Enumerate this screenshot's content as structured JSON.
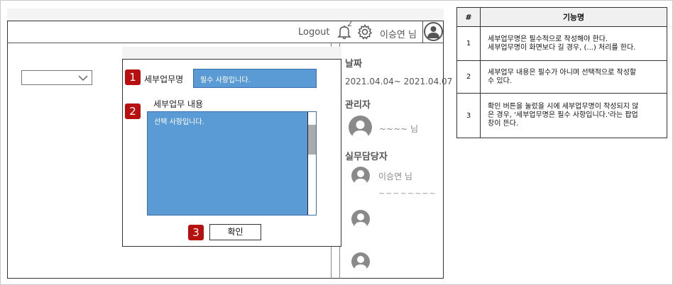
{
  "header": {
    "logout_label": "Logout",
    "notification_count": "2",
    "user_label": "이승연 님"
  },
  "sidebar_right": {
    "date_heading": "날짜",
    "date_range": "2021.04.04~ 2021.04.07",
    "manager_heading": "관리자",
    "manager_name": "~~~~ 님",
    "staff_heading": "실무담당자",
    "staff_name": "이승연 님",
    "staff_placeholder": "~~~~~~~~"
  },
  "dialog": {
    "badge1": "1",
    "name_label": "세부업무명",
    "name_placeholder": "필수 사항입니다.",
    "badge2": "2",
    "content_label": "세부업무 내용",
    "content_placeholder": "선택 사항입니다.",
    "badge3": "3",
    "confirm_label": "확인"
  },
  "spec_table": {
    "headers": [
      "#",
      "기능명"
    ],
    "rows": [
      {
        "num": "1",
        "line1": "세부업무명은 필수적으로 작성해야 한다.",
        "line2": "세부업무명이 화면보다 길 경우, (...) 처리를 한다."
      },
      {
        "num": "2",
        "line1": "세부업무 내용은 필수가 아니며 선택적으로 작성할",
        "line2": "수 있다."
      },
      {
        "num": "3",
        "line1": "확인 버튼을 눌렀을 시에 세부업무명이 작성되지 않",
        "line2": "은 경우, '세부업무명은 필수 사항입니다.'라는 팝업",
        "line3": "창이 뜬다."
      }
    ]
  }
}
